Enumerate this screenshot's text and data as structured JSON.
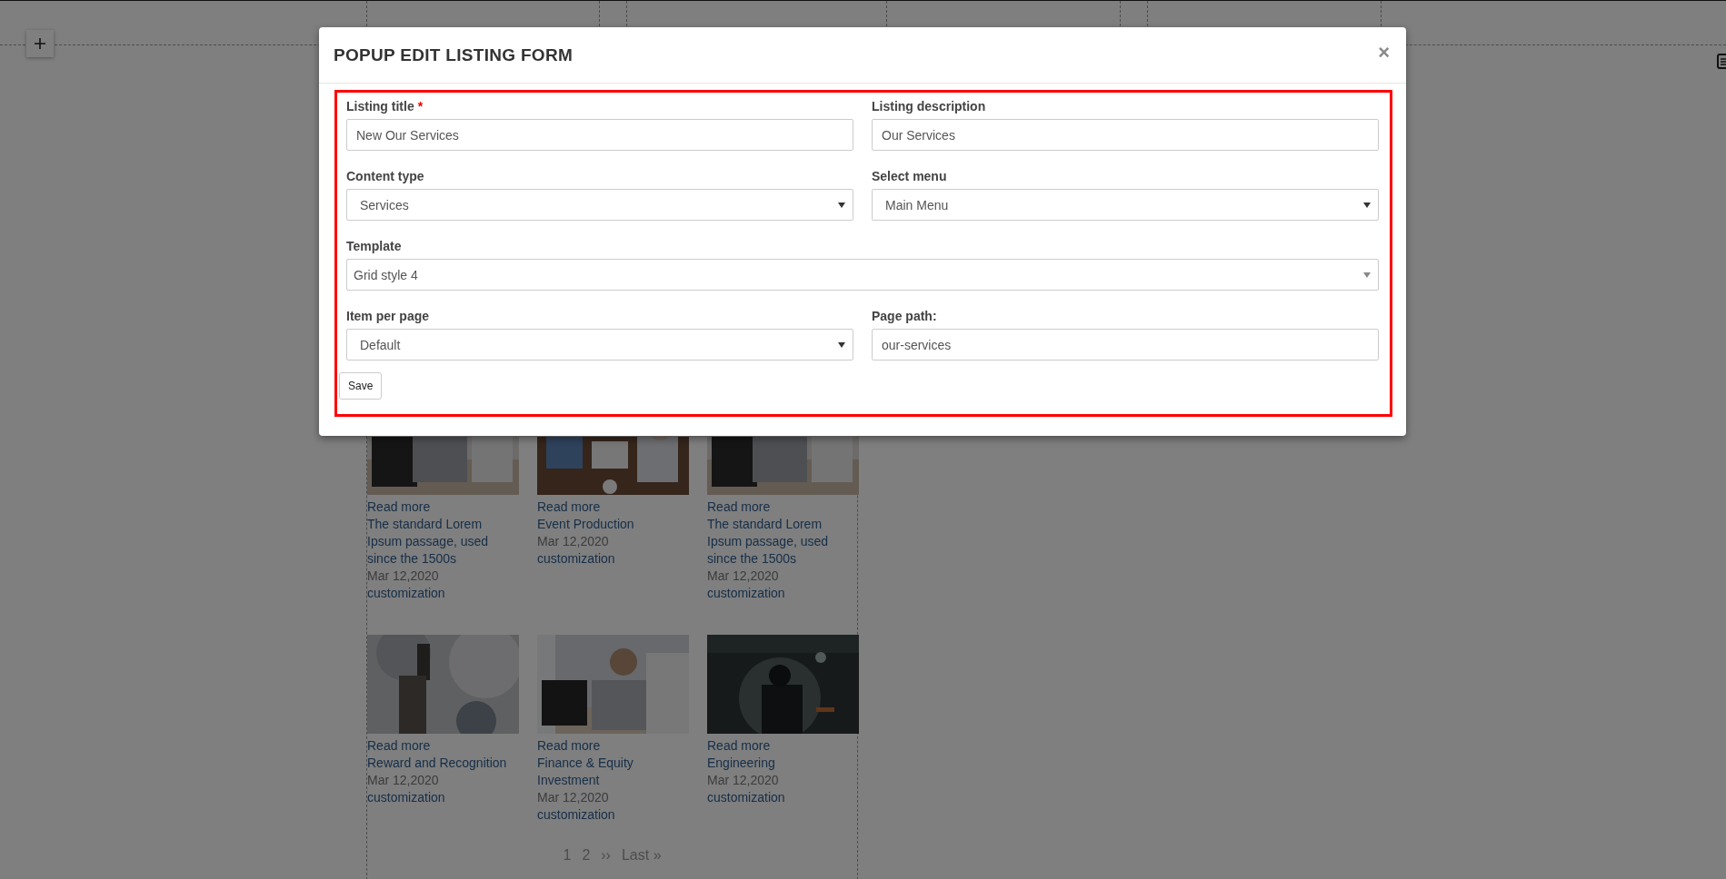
{
  "page": {
    "listings": [
      {
        "kind": "picture",
        "link": "Read more",
        "title": "The standard Lorem Ipsum passage, used since the 1500s",
        "date": "Mar 12,2020",
        "category": "customization"
      },
      {
        "kind": "picture",
        "link": "Read more",
        "title": "Event Production",
        "date": "Mar 12,2020",
        "category": "customization"
      },
      {
        "kind": "picture",
        "link": "Read more",
        "title": "The standard Lorem Ipsum passage, used since the 1500s",
        "date": "Mar 12,2020",
        "category": "customization"
      },
      {
        "kind": "picture",
        "link": "Read more",
        "title": "Reward and Recognition",
        "date": "Mar 12,2020",
        "category": "customization"
      },
      {
        "kind": "picture",
        "link": "Read more",
        "title": "Finance & Equity Investment",
        "date": "Mar 12,2020",
        "category": "customization"
      },
      {
        "kind": "picture",
        "link": "Read more",
        "title": "Engineering",
        "date": "Mar 12,2020",
        "category": "customization"
      }
    ],
    "pagination": [
      "1",
      "2",
      "››",
      "Last »"
    ]
  },
  "modal": {
    "title": "POPUP EDIT LISTING FORM",
    "close": "×",
    "required_mark": "*",
    "rows": [
      [
        {
          "kind": "text",
          "label": "Listing title",
          "required": true,
          "value": "New Our Services"
        },
        {
          "kind": "text",
          "label": "Listing description",
          "required": false,
          "value": "Our Services"
        }
      ],
      [
        {
          "kind": "select",
          "label": "Content type",
          "required": false,
          "value": "Services"
        },
        {
          "kind": "select",
          "label": "Select menu",
          "required": false,
          "value": "Main Menu"
        }
      ],
      [
        {
          "kind": "combobox",
          "label": "Template",
          "required": false,
          "value": "Grid style 4"
        }
      ],
      [
        {
          "kind": "select",
          "label": "Item per page",
          "required": false,
          "value": "Default"
        },
        {
          "kind": "text",
          "label": "Page path:",
          "required": false,
          "value": "our-services"
        }
      ]
    ],
    "save_button": "Save"
  }
}
